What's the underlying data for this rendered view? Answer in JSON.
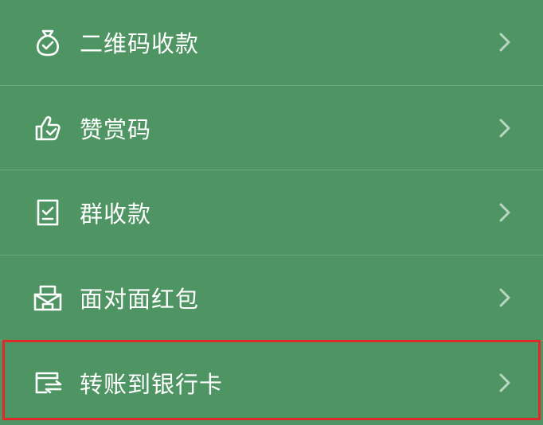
{
  "menu": {
    "items": [
      {
        "label": "二维码收款",
        "icon": "money-bag-icon"
      },
      {
        "label": "赞赏码",
        "icon": "thumbs-up-icon"
      },
      {
        "label": "群收款",
        "icon": "receipt-check-icon"
      },
      {
        "label": "面对面红包",
        "icon": "red-packet-icon"
      },
      {
        "label": "转账到银行卡",
        "icon": "bank-transfer-icon"
      }
    ]
  },
  "colors": {
    "background": "#4f9563",
    "text": "#ffffff",
    "chevron": "#b9d6c1",
    "highlight_border": "#e02a2a"
  }
}
